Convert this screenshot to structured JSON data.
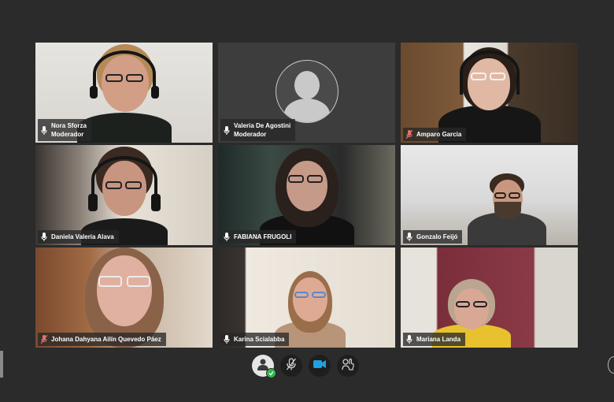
{
  "participants": [
    {
      "name": "Nora Sforza",
      "role": "Moderador",
      "mic": "on"
    },
    {
      "name": "Valeria De Agostini",
      "role": "Moderador",
      "mic": "on"
    },
    {
      "name": "Amparo Garcia",
      "role": "",
      "mic": "muted"
    },
    {
      "name": "Daniela Valeria Alava",
      "role": "",
      "mic": "on"
    },
    {
      "name": "FABIANA FRUGOLI",
      "role": "",
      "mic": "on"
    },
    {
      "name": "Gonzalo Feijó",
      "role": "",
      "mic": "on"
    },
    {
      "name": "Johana Dahyana Ailín Quevedo Páez",
      "role": "",
      "mic": "muted"
    },
    {
      "name": "Karina Scialabba",
      "role": "",
      "mic": "on"
    },
    {
      "name": "Mariana Landa",
      "role": "",
      "mic": "on"
    }
  ],
  "toolbar": {
    "buttons": [
      "profile-status",
      "mute-microphone",
      "camera",
      "screen-share"
    ]
  },
  "colors": {
    "background": "#2b2b2b",
    "active_speaker_border": "#e0756b",
    "camera_accent": "#1fa0e0",
    "status_green": "#2eb84b"
  }
}
